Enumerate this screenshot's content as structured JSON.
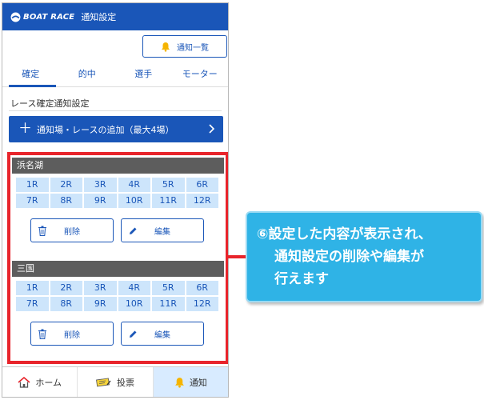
{
  "header": {
    "logo": "BOAT RACE",
    "title": "通知設定"
  },
  "notice_button": {
    "label": "通知一覧",
    "icon": "bell-icon"
  },
  "tabs": [
    {
      "label": "確定",
      "active": true
    },
    {
      "label": "的中",
      "active": false
    },
    {
      "label": "選手",
      "active": false
    },
    {
      "label": "モーター",
      "active": false
    }
  ],
  "section": {
    "title": "レース確定通知設定"
  },
  "add_button": {
    "plus": "＋",
    "label": "通知場・レースの追加（最大4場）"
  },
  "venues": [
    {
      "name": "浜名湖",
      "races": [
        "1R",
        "2R",
        "3R",
        "4R",
        "5R",
        "6R",
        "7R",
        "8R",
        "9R",
        "10R",
        "11R",
        "12R"
      ],
      "delete_label": "削除",
      "edit_label": "編集"
    },
    {
      "name": "三国",
      "races": [
        "1R",
        "2R",
        "3R",
        "4R",
        "5R",
        "6R",
        "7R",
        "8R",
        "9R",
        "10R",
        "11R",
        "12R"
      ],
      "delete_label": "削除",
      "edit_label": "編集"
    }
  ],
  "bottom_nav": [
    {
      "label": "ホーム",
      "icon": "home-icon",
      "active": false
    },
    {
      "label": "投票",
      "icon": "ticket-icon",
      "active": false
    },
    {
      "label": "通知",
      "icon": "bell-icon",
      "active": true
    }
  ],
  "callout": {
    "lines": [
      "⑥設定した内容が表示され、",
      "通知設定の削除や編集が",
      "行えます"
    ]
  },
  "colors": {
    "primary": "#1a56b8",
    "highlight": "#e8242b",
    "callout": "#2fb3e6",
    "race_cell": "#cde5fb",
    "venue_header": "#5d5d5d"
  }
}
